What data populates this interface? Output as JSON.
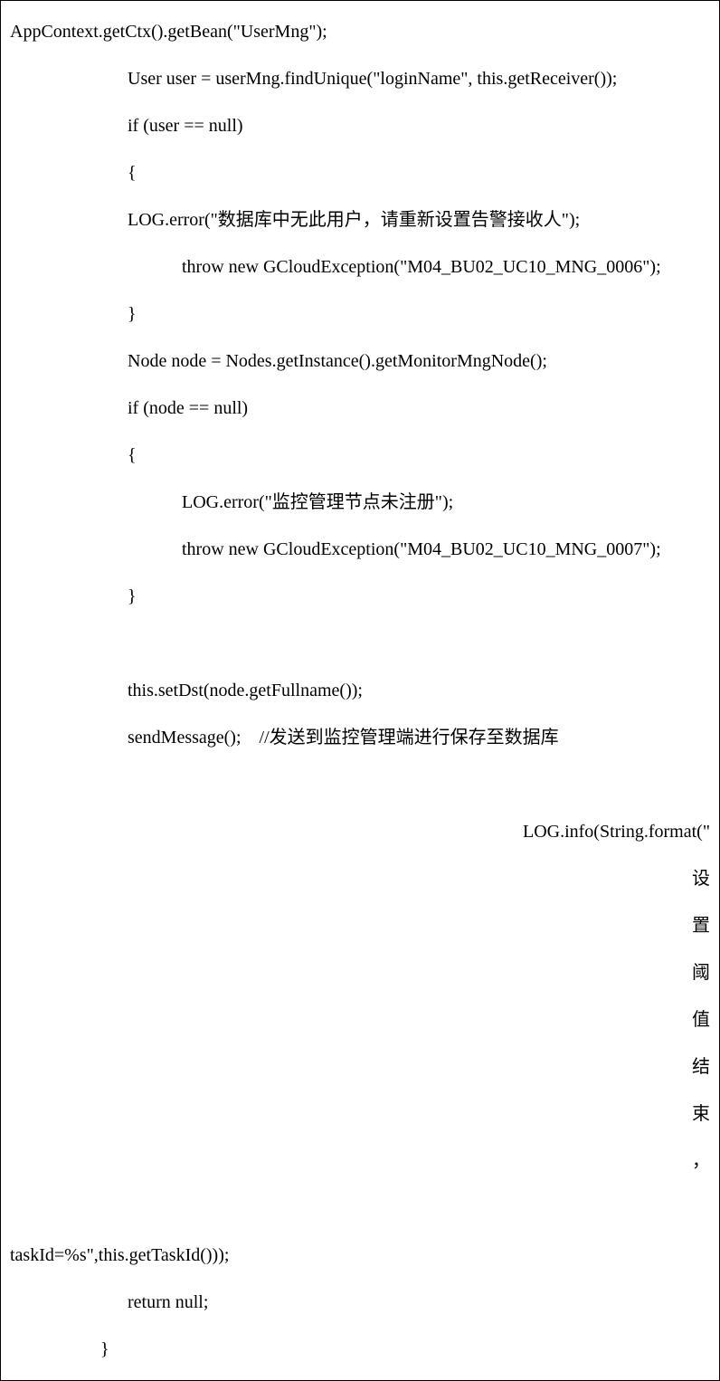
{
  "code": {
    "line1": "AppContext.getCtx().getBean(\"UserMng\");",
    "line2": "User user = userMng.findUnique(\"loginName\", this.getReceiver());",
    "line3": "if (user == null)",
    "line4": "{",
    "line5": "LOG.error(\"数据库中无此用户，请重新设置告警接收人\");",
    "line6": "throw new GCloudException(\"M04_BU02_UC10_MNG_0006\");",
    "line7": "}",
    "line8": "Node node = Nodes.getInstance().getMonitorMngNode();",
    "line9": "if (node == null)",
    "line10": "{",
    "line11": "LOG.error(\"监控管理节点未注册\");",
    "line12": "throw new GCloudException(\"M04_BU02_UC10_MNG_0007\");",
    "line13": "}",
    "blank": " ",
    "line14": "this.setDst(node.getFullname());",
    "line15": "sendMessage();    //发送到监控管理端进行保存至数据库",
    "line16_part1": "LOG.info(String.format(\"",
    "line16_char1": "设",
    "line16_char2": "置",
    "line16_char3": "阈",
    "line16_char4": "值",
    "line16_char5": "结",
    "line16_char6": "束",
    "line16_char7": "，",
    "line17": "taskId=%s\",this.getTaskId()));",
    "line18": "return null;",
    "line19": "}"
  }
}
